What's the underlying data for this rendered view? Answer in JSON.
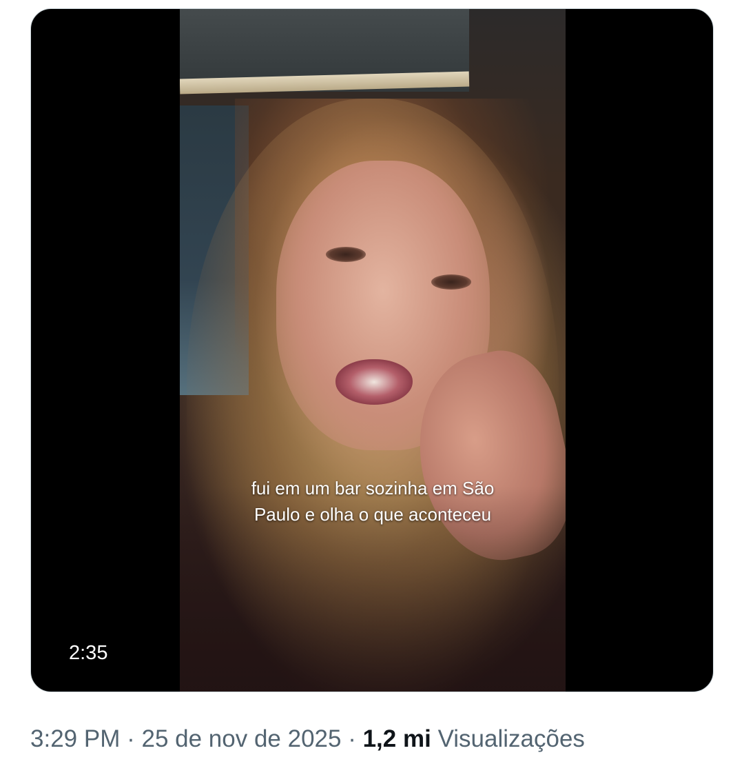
{
  "video": {
    "caption_lines": [
      "fui em um bar sozinha em São",
      "Paulo e olha o que aconteceu"
    ],
    "duration": "2:35"
  },
  "tweet_meta": {
    "time": "3:29 PM",
    "separator": "·",
    "date": "25 de nov de 2025",
    "views_count": "1,2 mi",
    "views_label": "Visualizações"
  },
  "colors": {
    "meta_text": "#536471",
    "views_count_text": "#0f1419",
    "media_background": "#000000"
  }
}
